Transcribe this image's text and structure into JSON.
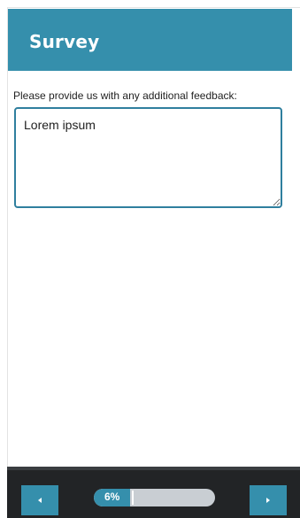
{
  "header": {
    "title": "Survey"
  },
  "question": {
    "label": "Please provide us with any additional feedback:",
    "answer_value": "Lorem ipsum"
  },
  "footer": {
    "progress_label": "6%",
    "progress_fraction": 0.06,
    "prev_icon": "triangle-left-icon",
    "next_icon": "triangle-right-icon"
  },
  "colors": {
    "accent": "#358fac",
    "footer_bg": "#222426",
    "progress_track": "#c9ced3"
  }
}
